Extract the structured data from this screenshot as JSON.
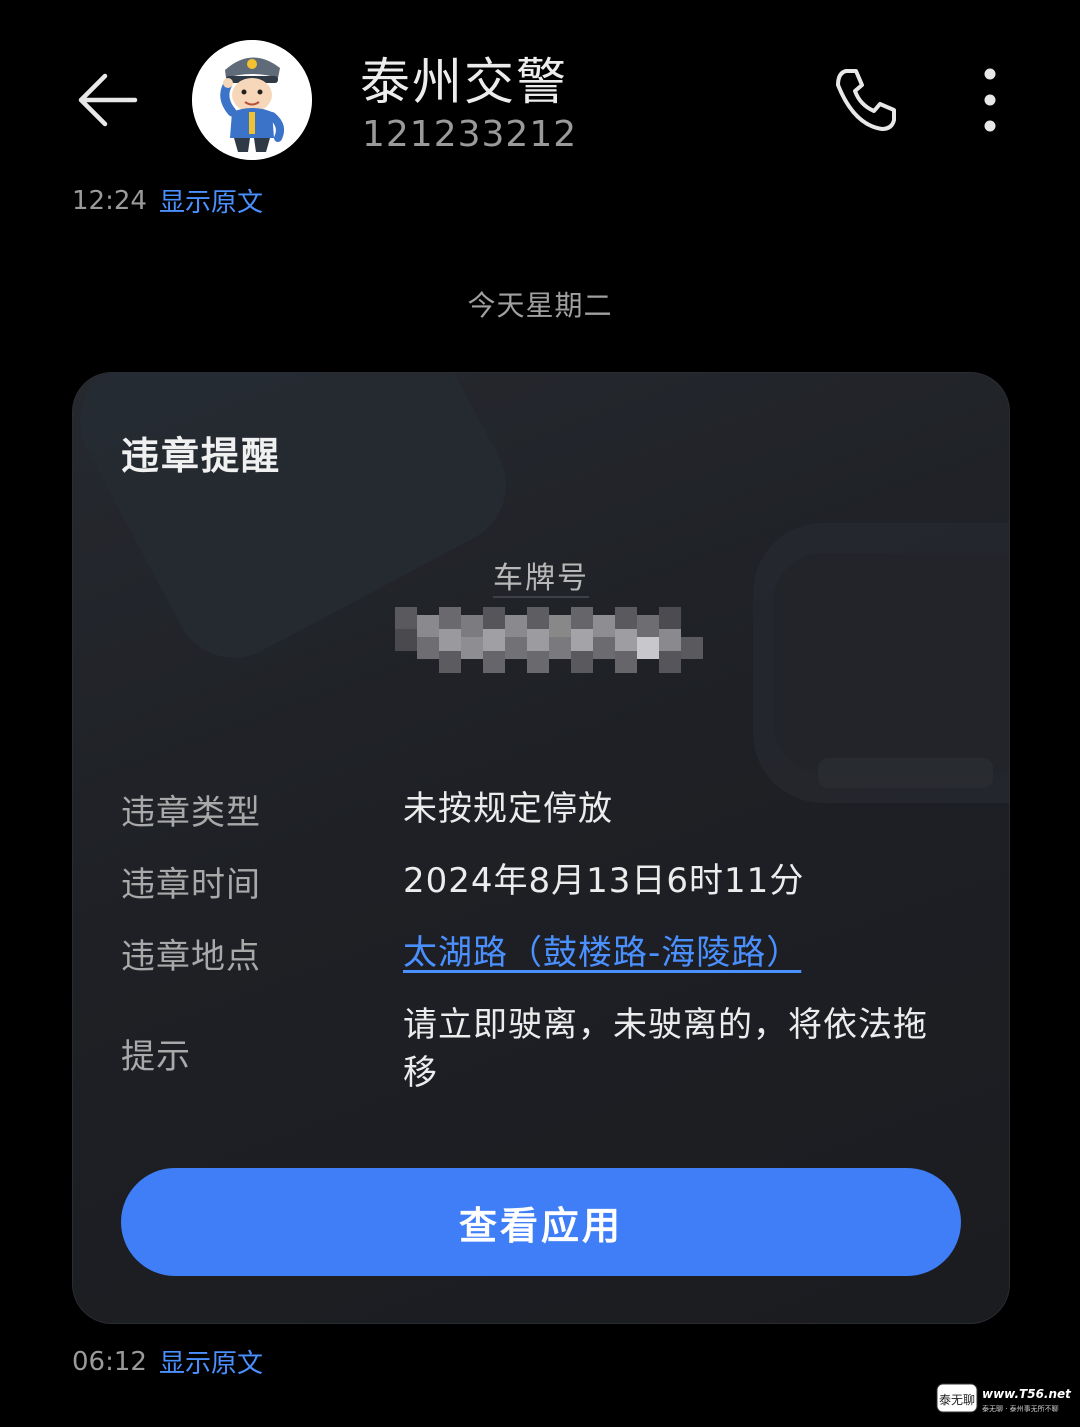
{
  "header": {
    "contact_name": "泰州交警",
    "contact_number": "121233212"
  },
  "messages": [
    {
      "time": "12:24",
      "show_original": "显示原文"
    },
    {
      "time": "06:12",
      "show_original": "显示原文"
    }
  ],
  "date_separator": "今天星期二",
  "card": {
    "title": "违章提醒",
    "plate_label": "车牌号",
    "rows": [
      {
        "key": "违章类型",
        "value": "未按规定停放"
      },
      {
        "key": "违章时间",
        "value": "2024年8月13日6时11分"
      },
      {
        "key": "违章地点",
        "value": "太湖路（鼓楼路-海陵路）"
      },
      {
        "key": "提示",
        "value": "请立即驶离，未驶离的，将依法拖移"
      }
    ],
    "button_label": "查看应用"
  },
  "watermark": {
    "brand": "泰无聊",
    "url": "www.T56.net",
    "tagline": "泰无聊 · 泰州事无所不聊"
  },
  "colors": {
    "background": "#000000",
    "card_bg": "#1e2025",
    "accent_blue": "#3f7ef6",
    "link_blue": "#4a90ff"
  },
  "icons": {
    "back": "arrow-left-icon",
    "call": "phone-icon",
    "more": "more-vertical-icon",
    "avatar": "traffic-police-avatar"
  }
}
